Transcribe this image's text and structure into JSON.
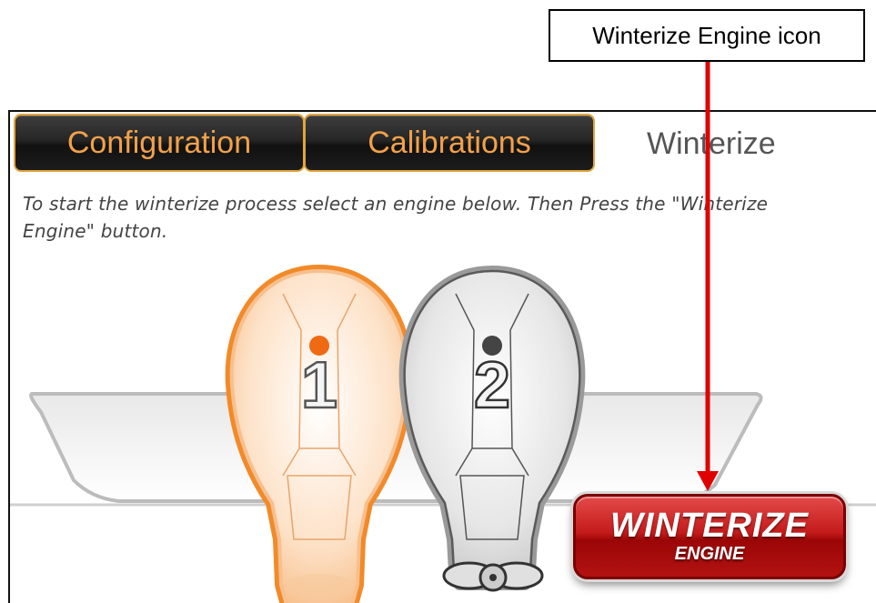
{
  "callout": {
    "label": "Winterize Engine icon"
  },
  "tabs": {
    "configuration": "Configuration",
    "calibrations": "Calibrations",
    "winterize": "Winterize"
  },
  "instructions": "To start the winterize process select an engine below. Then Press the \"Winterize Engine\" button.",
  "engines": [
    {
      "number": "1",
      "selected": true,
      "color": "#f07c1a"
    },
    {
      "number": "2",
      "selected": false,
      "color": "#555555"
    }
  ],
  "winterize_button": {
    "line1": "WINTERIZE",
    "line2": "ENGINE",
    "color": "#c41b1b"
  },
  "arrow_color": "#e00000"
}
